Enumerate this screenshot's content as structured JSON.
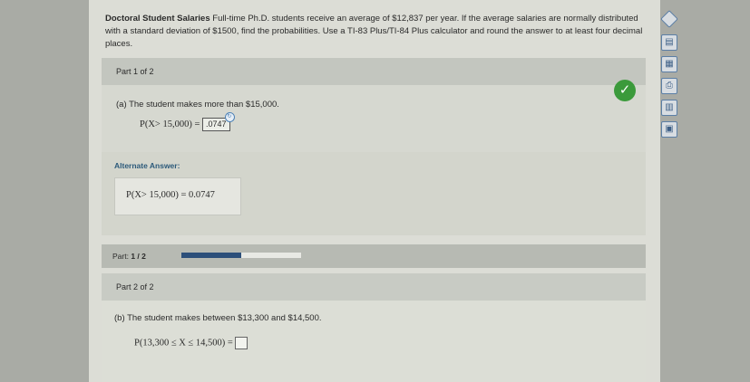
{
  "problem": {
    "title": "Doctoral Student Salaries",
    "text": "Full-time Ph.D. students receive an average of $12,837 per year. If the average salaries are normally distributed with a standard deviation of $1500, find the probabilities. Use a TI-83 Plus/TI-84 Plus calculator and round the answer to at least four decimal places."
  },
  "part1": {
    "header": "Part 1 of 2",
    "question": "(a) The student makes more than $15,000.",
    "expression": "P(X> 15,000) =",
    "answer": ".0747",
    "status": "correct",
    "alternate_label": "Alternate Answer:",
    "alternate_answer": "P(X> 15,000) = 0.0747"
  },
  "progress": {
    "label": "Part:",
    "value_text": "1 / 2",
    "fraction": 0.5
  },
  "part2": {
    "header": "Part 2 of 2",
    "question": "(b) The student makes between $13,300 and $14,500.",
    "expression": "P(13,300 ≤ X ≤ 14,500) =",
    "answer": ""
  },
  "toolbar": {
    "icons": [
      "diamond-icon",
      "print-icon",
      "calculator-icon",
      "printer-icon",
      "chart-icon",
      "table-icon"
    ]
  },
  "colors": {
    "progress_fill": "#2c4f7a",
    "check": "#3b9a3b",
    "alt_label": "#2c5a7a"
  }
}
